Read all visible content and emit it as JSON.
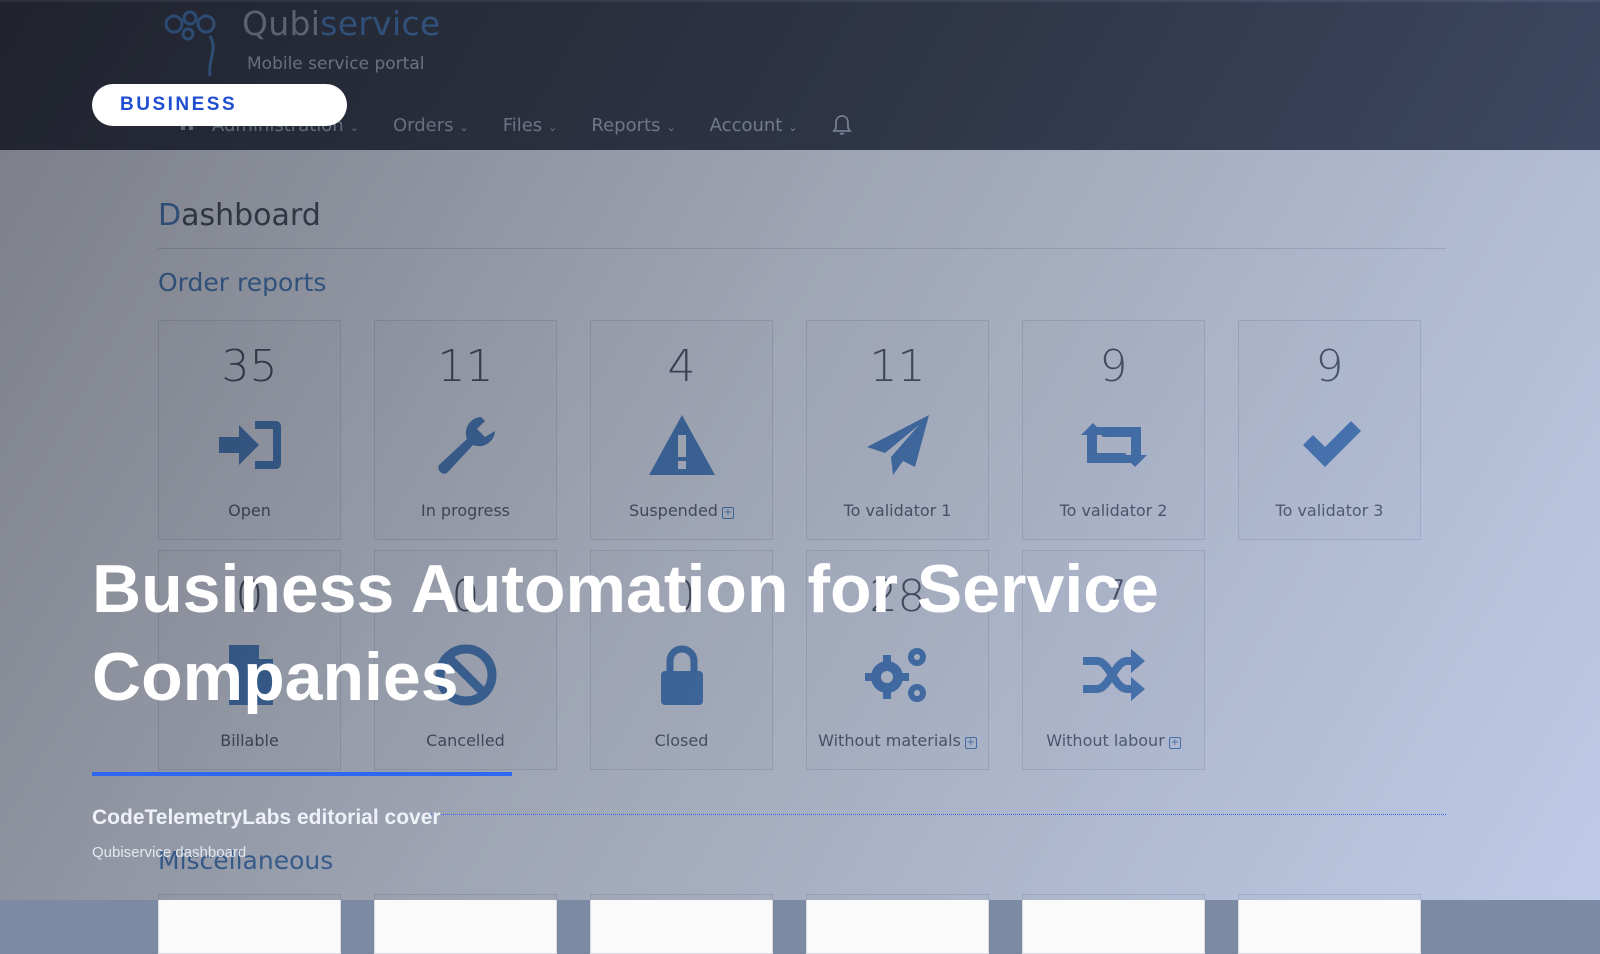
{
  "app": {
    "brand_prefix": "Qubi",
    "brand_suffix": "service",
    "tagline": "Mobile service portal"
  },
  "nav": {
    "items": [
      {
        "label": "Administration"
      },
      {
        "label": "Orders"
      },
      {
        "label": "Files"
      },
      {
        "label": "Reports"
      },
      {
        "label": "Account"
      }
    ],
    "home_icon": "home-icon",
    "bell_icon": "bell-icon"
  },
  "page": {
    "title_initial": "D",
    "title_rest": "ashboard",
    "section_order_reports": "Order reports",
    "section_misc": "Miscellaneous"
  },
  "tiles": [
    {
      "count": "35",
      "label": "Open",
      "icon": "sign-in-icon"
    },
    {
      "count": "11",
      "label": "In progress",
      "icon": "wrench-icon"
    },
    {
      "count": "4",
      "label": "Suspended",
      "icon": "warning-icon",
      "expand": true
    },
    {
      "count": "11",
      "label": "To validator 1",
      "icon": "send-icon"
    },
    {
      "count": "9",
      "label": "To validator 2",
      "icon": "retweet-icon"
    },
    {
      "count": "9",
      "label": "To validator 3",
      "icon": "check-icon"
    },
    {
      "count": "0",
      "label": "Billable",
      "icon": "file-icon"
    },
    {
      "count": "0",
      "label": "Cancelled",
      "icon": "cancel-circle-icon"
    },
    {
      "count": "0",
      "label": "Closed",
      "icon": "lock-icon"
    },
    {
      "count": "28",
      "label": "Without materials",
      "icon": "gears-icon",
      "expand": true
    },
    {
      "count": "7",
      "label": "Without labour",
      "icon": "shuffle-icon",
      "expand": true
    }
  ],
  "overlay": {
    "tag": "BUSINESS",
    "headline": "Business Automation for Service Companies",
    "byline": "CodeTelemetryLabs editorial cover",
    "caption": "Qubiservice dashboard"
  },
  "colors": {
    "accent": "#2f68f0",
    "brand_blue": "#2c6fb8",
    "topbar": "#15161b"
  }
}
